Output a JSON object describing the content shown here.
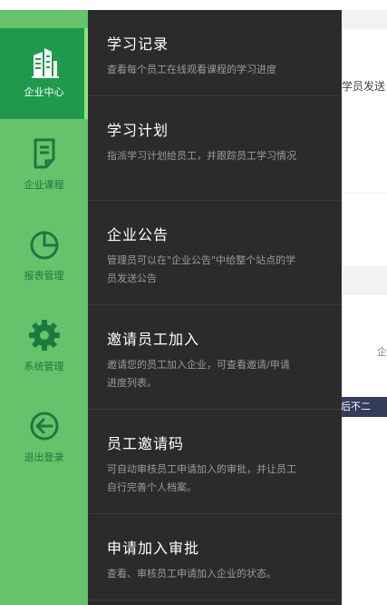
{
  "background": {
    "partial_text_1": "学员发送",
    "partial_text_2": "企",
    "badge": "后不二"
  },
  "rail": {
    "items": [
      {
        "label": "企业中心",
        "icon": "building-icon",
        "active": true
      },
      {
        "label": "企业课程",
        "icon": "document-icon",
        "active": false
      },
      {
        "label": "报表管理",
        "icon": "pie-chart-icon",
        "active": false
      },
      {
        "label": "系统管理",
        "icon": "gear-icon",
        "active": false
      },
      {
        "label": "退出登录",
        "icon": "logout-arrow-icon",
        "active": false
      }
    ]
  },
  "panel": {
    "entries": [
      {
        "title": "学习记录",
        "desc": "查看每个员工在线观看课程的学习进度"
      },
      {
        "title": "学习计划",
        "desc": "指派学习计划给员工，并跟踪员工学习情况"
      },
      {
        "title": "企业公告",
        "desc": "管理员可以在\"企业公告\"中给整个站点的学员发送公告"
      },
      {
        "title": "邀请员工加入",
        "desc": "邀请您的员工加入企业，可查看邀请/申请进度列表。"
      },
      {
        "title": "员工邀请码",
        "desc": "可自动审核员工申请加入的审批，并让员工自行完善个人档案。"
      },
      {
        "title": "申请加入审批",
        "desc": "查看、审核员工申请加入企业的状态。"
      }
    ]
  },
  "colors": {
    "rail": "#66c36b",
    "rail_active": "#1f9a4c",
    "panel": "#2b2b2b",
    "accent": "#8de47e"
  }
}
